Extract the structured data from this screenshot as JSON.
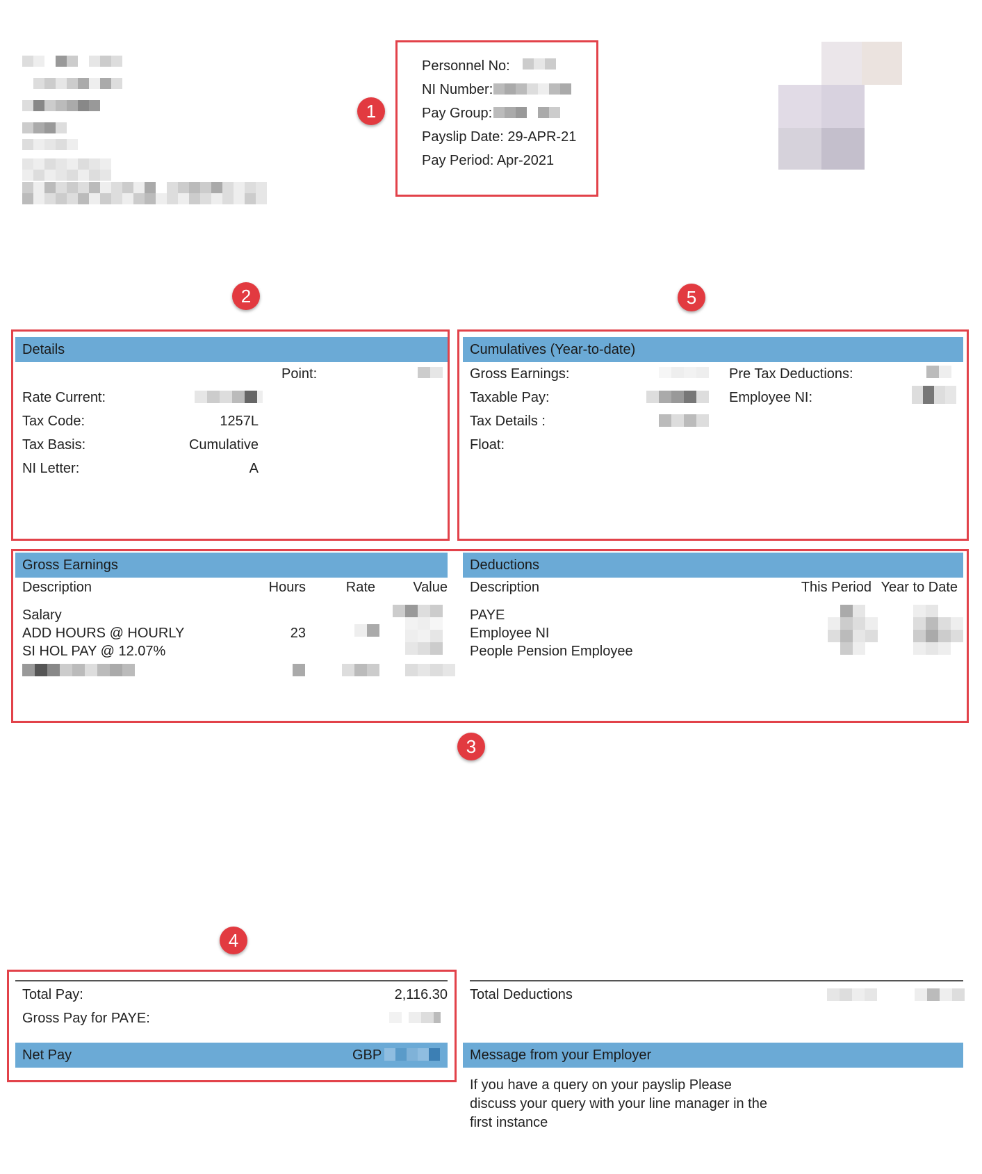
{
  "header": {
    "personnel_no_label": "Personnel No:",
    "ni_number_label": "NI Number:",
    "pay_group_label": "Pay Group:",
    "payslip_date": "Payslip Date: 29-APR-21",
    "pay_period": "Pay Period: Apr-2021"
  },
  "badges": [
    "1",
    "2",
    "3",
    "4",
    "5"
  ],
  "details": {
    "title": "Details",
    "point_label": "Point:",
    "rate_current_label": "Rate Current:",
    "tax_code_label": "Tax Code:",
    "tax_code_value": "1257L",
    "tax_basis_label": "Tax Basis:",
    "tax_basis_value": "Cumulative",
    "ni_letter_label": "NI Letter:",
    "ni_letter_value": "A"
  },
  "cumulatives": {
    "title": "Cumulatives (Year-to-date)",
    "gross_earnings_label": "Gross Earnings:",
    "taxable_pay_label": "Taxable Pay:",
    "tax_details_label": "Tax Details :",
    "float_label": "Float:",
    "pre_tax_label": "Pre Tax Deductions:",
    "employee_ni_label": "Employee NI:"
  },
  "earnings": {
    "title": "Gross Earnings",
    "headers": [
      "Description",
      "Hours",
      "Rate",
      "Value"
    ],
    "rows": [
      {
        "description": "Salary",
        "hours": ""
      },
      {
        "description": "ADD HOURS @ HOURLY",
        "hours": "23"
      },
      {
        "description": "SI HOL PAY @ 12.07%",
        "hours": ""
      }
    ]
  },
  "deductions": {
    "title": "Deductions",
    "headers": [
      "Description",
      "This Period",
      "Year to Date"
    ],
    "rows": [
      "PAYE",
      "Employee NI",
      "People Pension Employee"
    ]
  },
  "totals": {
    "total_pay_label": "Total Pay:",
    "total_pay_value": "2,116.30",
    "gross_paye_label": "Gross Pay for PAYE:",
    "net_pay_label": "Net Pay",
    "net_pay_currency": "GBP",
    "total_deductions_label": "Total Deductions"
  },
  "message": {
    "title": "Message from your Employer",
    "body": "If you have a query on your payslip Please discuss your query with your line manager in the first instance"
  },
  "colors": {
    "band": "#6baad6",
    "highlight": "#e2424a"
  }
}
